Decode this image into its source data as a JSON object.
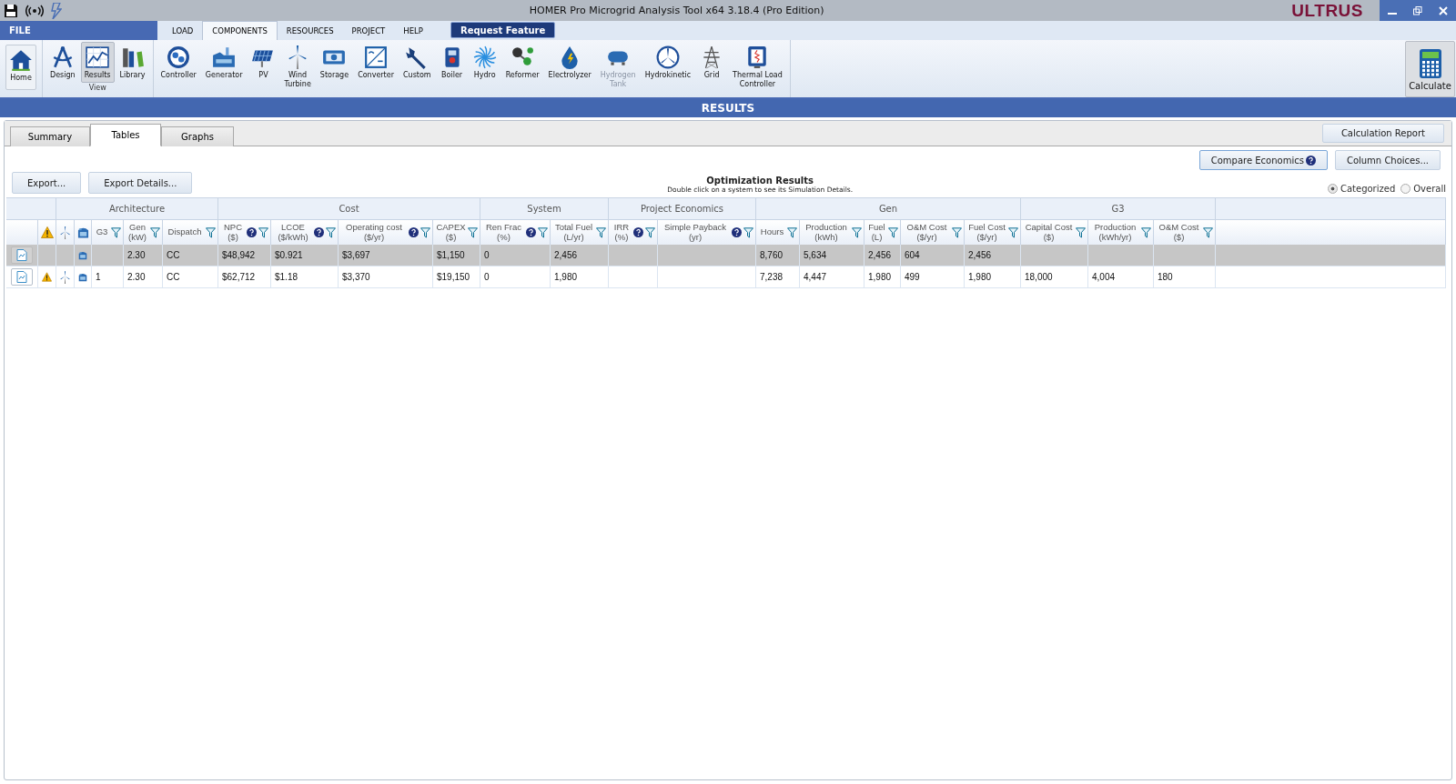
{
  "window": {
    "title": "HOMER Pro Microgrid Analysis Tool   x64 3.18.4 (Pro Edition)",
    "brand": "ULTRUS"
  },
  "ribbon": {
    "file_menu": "FILE",
    "tabs": [
      {
        "label": "LOAD",
        "selected": false
      },
      {
        "label": "COMPONENTS",
        "selected": true
      },
      {
        "label": "RESOURCES",
        "selected": false
      },
      {
        "label": "PROJECT",
        "selected": false
      },
      {
        "label": "HELP",
        "selected": false
      }
    ],
    "request_feature": "Request Feature",
    "home": "Home",
    "view_group": {
      "label": "View",
      "items": [
        {
          "label": "Design",
          "selected": false
        },
        {
          "label": "Results",
          "selected": true
        },
        {
          "label": "Library",
          "selected": false
        }
      ]
    },
    "components": [
      {
        "label": "Controller",
        "disabled": false
      },
      {
        "label": "Generator",
        "disabled": false
      },
      {
        "label": "PV",
        "disabled": false
      },
      {
        "label": "Wind\nTurbine",
        "disabled": false
      },
      {
        "label": "Storage",
        "disabled": false
      },
      {
        "label": "Converter",
        "disabled": false
      },
      {
        "label": "Custom",
        "disabled": false
      },
      {
        "label": "Boiler",
        "disabled": false
      },
      {
        "label": "Hydro",
        "disabled": false
      },
      {
        "label": "Reformer",
        "disabled": false
      },
      {
        "label": "Electrolyzer",
        "disabled": false
      },
      {
        "label": "Hydrogen\nTank",
        "disabled": true
      },
      {
        "label": "Hydrokinetic",
        "disabled": false
      },
      {
        "label": "Grid",
        "disabled": false
      },
      {
        "label": "Thermal Load\nController",
        "disabled": false
      }
    ],
    "calculate": "Calculate"
  },
  "results_bar": "RESULTS",
  "tabs": [
    {
      "label": "Summary",
      "selected": false
    },
    {
      "label": "Tables",
      "selected": true
    },
    {
      "label": "Graphs",
      "selected": false
    }
  ],
  "calculation_report": "Calculation Report",
  "compare_economics": "Compare Economics",
  "column_choices": "Column Choices...",
  "export_buttons": [
    "Export...",
    "Export Details..."
  ],
  "title": "Optimization Results",
  "subtitle": "Double click on a system to see its Simulation Details.",
  "view_mode": [
    {
      "label": "Categorized",
      "selected": true
    },
    {
      "label": "Overall",
      "selected": false
    }
  ],
  "table": {
    "groups": [
      {
        "label": "Architecture"
      },
      {
        "label": "Cost"
      },
      {
        "label": "System"
      },
      {
        "label": "Project Economics"
      },
      {
        "label": "Gen"
      },
      {
        "label": "G3"
      }
    ],
    "columns": [
      {
        "label": "G3",
        "help": false
      },
      {
        "label": "Gen",
        "unit": "(kW)",
        "help": false
      },
      {
        "label": "Dispatch",
        "help": false
      },
      {
        "label": "NPC",
        "unit": "($)",
        "help": true
      },
      {
        "label": "LCOE",
        "unit": "($/kWh)",
        "help": true
      },
      {
        "label": "Operating cost",
        "unit": "($/yr)",
        "help": true
      },
      {
        "label": "CAPEX",
        "unit": "($)",
        "help": false
      },
      {
        "label": "Ren Frac",
        "unit": "(%)",
        "help": true
      },
      {
        "label": "Total Fuel",
        "unit": "(L/yr)",
        "help": false
      },
      {
        "label": "IRR",
        "unit": "(%)",
        "help": true
      },
      {
        "label": "Simple Payback",
        "unit": "(yr)",
        "help": true
      },
      {
        "label": "Hours",
        "help": false
      },
      {
        "label": "Production",
        "unit": "(kWh)",
        "help": false
      },
      {
        "label": "Fuel",
        "unit": "(L)",
        "help": false
      },
      {
        "label": "O&M Cost",
        "unit": "($/yr)",
        "help": false
      },
      {
        "label": "Fuel Cost",
        "unit": "($/yr)",
        "help": false
      },
      {
        "label": "Capital Cost",
        "unit": "($)",
        "help": false
      },
      {
        "label": "Production",
        "unit": "(kWh/yr)",
        "help": false
      },
      {
        "label": "O&M Cost",
        "unit": "($)",
        "help": false
      }
    ],
    "rows": [
      {
        "selected": true,
        "warning": false,
        "wind": false,
        "generator": true,
        "cells": [
          null,
          "2.30",
          "CC",
          "$48,942",
          "$0.921",
          "$3,697",
          "$1,150",
          "0",
          "2,456",
          null,
          null,
          "8,760",
          "5,634",
          "2,456",
          "604",
          "2,456",
          null,
          null,
          null
        ]
      },
      {
        "selected": false,
        "warning": true,
        "wind": true,
        "generator": true,
        "cells": [
          "1",
          "2.30",
          "CC",
          "$62,712",
          "$1.18",
          "$3,370",
          "$19,150",
          "0",
          "1,980",
          null,
          null,
          "7,238",
          "4,447",
          "1,980",
          "499",
          "1,980",
          "18,000",
          "4,004",
          "180"
        ]
      }
    ]
  }
}
